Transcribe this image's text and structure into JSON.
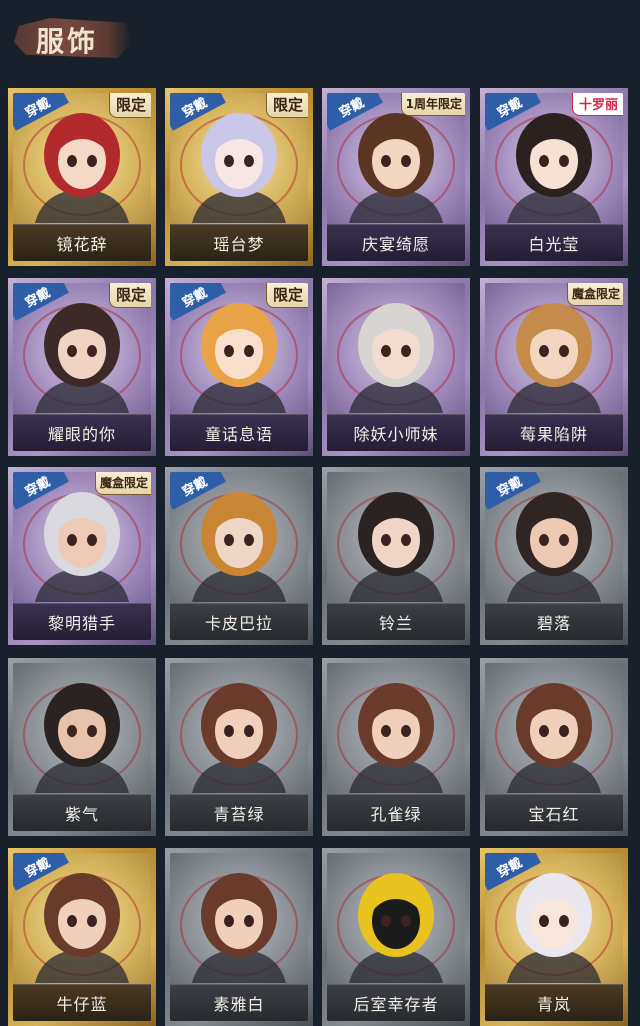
{
  "header": {
    "title": "服饰"
  },
  "items": [
    {
      "name": "镜花辞",
      "frame": "gold",
      "worn": true,
      "badge": "限定",
      "badge_style": "normal",
      "hair": "#b32a2c",
      "skin": "#f4d9c6"
    },
    {
      "name": "瑶台梦",
      "frame": "gold",
      "worn": true,
      "badge": "限定",
      "badge_style": "normal",
      "hair": "#c9c6e7",
      "skin": "#f6e7e4"
    },
    {
      "name": "庆宴绮愿",
      "frame": "purple",
      "worn": true,
      "badge": "1周年限定",
      "badge_style": "small",
      "hair": "#5a3522",
      "skin": "#f1d6c2"
    },
    {
      "name": "白光莹",
      "frame": "purple",
      "worn": true,
      "badge": "十罗丽",
      "badge_style": "pink",
      "hair": "#2b2220",
      "skin": "#f5e2d4"
    },
    {
      "name": "耀眼的你",
      "frame": "purple",
      "worn": true,
      "badge": "限定",
      "badge_style": "normal",
      "hair": "#3c2a28",
      "skin": "#f1d3c4"
    },
    {
      "name": "童话息语",
      "frame": "purple",
      "worn": true,
      "badge": "限定",
      "badge_style": "normal",
      "hair": "#e8a346",
      "skin": "#f8e0cc"
    },
    {
      "name": "除妖小师妹",
      "frame": "purple",
      "worn": false,
      "badge": "",
      "badge_style": "normal",
      "hair": "#d8d4d1",
      "skin": "#f1ddd0"
    },
    {
      "name": "莓果陷阱",
      "frame": "purple",
      "worn": false,
      "badge": "魔盒限定",
      "badge_style": "small",
      "hair": "#c58b4a",
      "skin": "#f2d6c0"
    },
    {
      "name": "黎明猎手",
      "frame": "purple",
      "worn": true,
      "badge": "魔盒限定",
      "badge_style": "small",
      "hair": "#d9d9df",
      "skin": "#eec9b6"
    },
    {
      "name": "卡皮巴拉",
      "frame": "gray",
      "worn": true,
      "badge": "",
      "badge_style": "normal",
      "hair": "#c98634",
      "skin": "#efd7c8"
    },
    {
      "name": "铃兰",
      "frame": "gray",
      "worn": false,
      "badge": "",
      "badge_style": "normal",
      "hair": "#2a2321",
      "skin": "#efd5c6"
    },
    {
      "name": "碧落",
      "frame": "gray",
      "worn": true,
      "badge": "",
      "badge_style": "normal",
      "hair": "#2f2624",
      "skin": "#edc9b1"
    },
    {
      "name": "紫气",
      "frame": "gray",
      "worn": false,
      "badge": "",
      "badge_style": "normal",
      "hair": "#2a2322",
      "skin": "#e8c2aa"
    },
    {
      "name": "青苔绿",
      "frame": "gray",
      "worn": false,
      "badge": "",
      "badge_style": "normal",
      "hair": "#6a3b2a",
      "skin": "#f0cfbb"
    },
    {
      "name": "孔雀绿",
      "frame": "gray",
      "worn": false,
      "badge": "",
      "badge_style": "normal",
      "hair": "#6a3b2a",
      "skin": "#f0cfbb"
    },
    {
      "name": "宝石红",
      "frame": "gray",
      "worn": false,
      "badge": "",
      "badge_style": "normal",
      "hair": "#6a3b2a",
      "skin": "#f0cfbb"
    },
    {
      "name": "牛仔蓝",
      "frame": "gold",
      "worn": true,
      "badge": "",
      "badge_style": "normal",
      "hair": "#6a3b2a",
      "skin": "#f0cfbb"
    },
    {
      "name": "素雅白",
      "frame": "gray",
      "worn": false,
      "badge": "",
      "badge_style": "normal",
      "hair": "#6a3b2a",
      "skin": "#f0cfbb"
    },
    {
      "name": "后室幸存者",
      "frame": "gray",
      "worn": false,
      "badge": "",
      "badge_style": "normal",
      "hair": "#e8c21e",
      "skin": "#1b1b1b"
    },
    {
      "name": "青岚",
      "frame": "gold",
      "worn": true,
      "badge": "",
      "badge_style": "normal",
      "hair": "#e9e6ee",
      "skin": "#f7e6dc"
    }
  ],
  "worn_label": "穿戴"
}
